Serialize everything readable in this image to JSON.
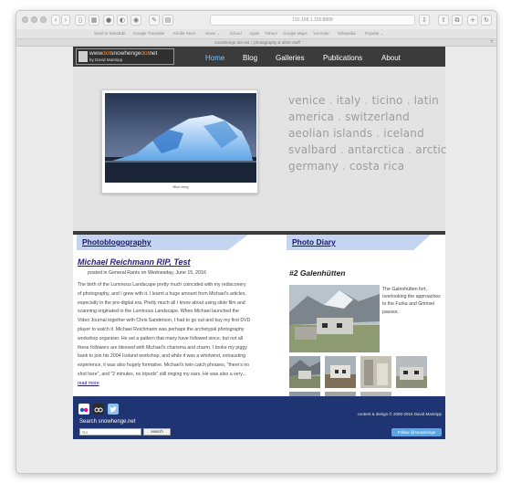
{
  "browser": {
    "url": "192.168.1.156:8888",
    "tab_title": "snowhenge dot net :: photography & other stuff",
    "bookmarks": [
      "Send to MarsEdit",
      "Google Translate",
      "Kindle Store",
      "News ⌄",
      "iCloud",
      "Apple",
      "Yahoo!",
      "Google Maps",
      "YouTube",
      "Wikipedia",
      "Popular ⌄"
    ],
    "new_tab_label": "+"
  },
  "site": {
    "logo": {
      "prefix": "www",
      "dot1": "dot",
      "middle": "snowhenge",
      "dot2": "dot",
      "suffix": "net",
      "byline": "by David Mantripp"
    },
    "nav": [
      {
        "label": "Home",
        "active": true
      },
      {
        "label": "Blog",
        "active": false
      },
      {
        "label": "Galleries",
        "active": false
      },
      {
        "label": "Publications",
        "active": false
      },
      {
        "label": "About",
        "active": false
      }
    ],
    "hero": {
      "photo_caption": "Blue berg",
      "destination_lines": [
        [
          "venice",
          "italy",
          "ticino",
          "latin"
        ],
        [
          "america",
          "switzerland"
        ],
        [
          "aeolian islands",
          "iceland"
        ],
        [
          "svalbard",
          "antarctica",
          "arctic"
        ],
        [
          "germany",
          "costa rica"
        ]
      ],
      "separator": "."
    },
    "photoblog": {
      "heading": "Photoblogography",
      "post_title": "Michael Reichmann RIP, Test",
      "post_meta": "posted in General Rants on Wednesday, June 15, 2016",
      "post_body": "The birth of the Luminous Landscape pretty much coincided with my rediscovery of photography, and I grew with it. I learnt a huge amount from Michael's articles, especially in the pre-digital era. Pretty much all I know about using slide film and scanning originated in the Luminous Landscape. When Michael launched the Video Journal together with Chris Sanderson, I had to go out and buy my first DVD player to watch it. Michael Reichmann was perhaps the archetypal photography workshop organiser. He set a pattern that many have followed since, but not all these followers are blessed with Michael's charisma and charm. I broke my piggy bank to join his 2004 Iceland workshop, and while it was a whirlwind, exhausting experience, it was also hugely formative. Michael's twin catch phrases, \"there's no shot here\", and \"2 minutes, no tripods\" still ringing my ears. He was also a very...",
      "read_more": "read more"
    },
    "photo_diary": {
      "heading": "Photo Diary",
      "entry_title": "#2 Galenhütten",
      "entry_description": "The Galenhütten fort, overlooking the approaches to the Furka and Grimsel passes."
    },
    "footer": {
      "copyright": "content & design © 2000-2016 David Mantripp",
      "search_label": "Search snowhenge.net",
      "search_placeholder": "Go",
      "search_button": "search",
      "follow_button": "Follow @snowhenge"
    }
  }
}
